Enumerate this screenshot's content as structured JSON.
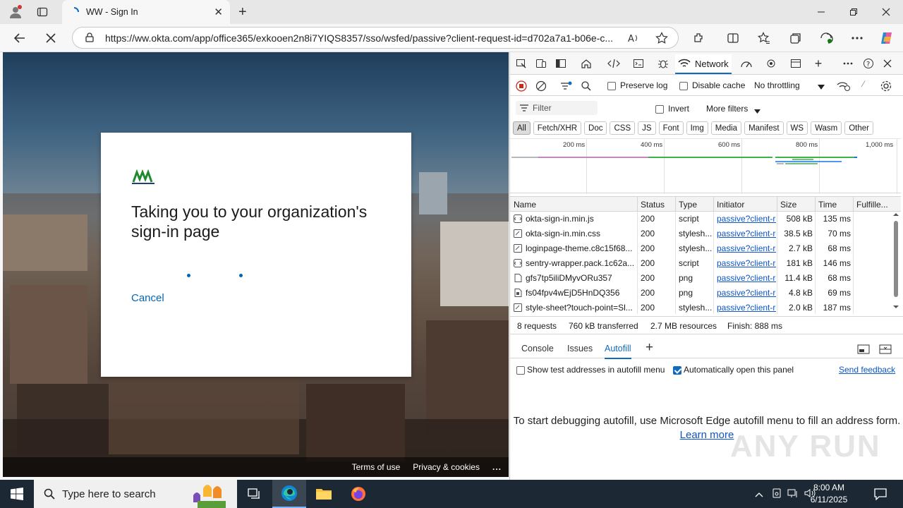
{
  "browser": {
    "tab_title": "WW - Sign In",
    "url": "https://ww.okta.com/app/office365/exkooen2n8i7YIQS8357/sso/wsfed/passive?client-request-id=d702a7a1-b06e-c..."
  },
  "signin_card": {
    "heading": "Taking you to your organization's sign-in page",
    "cancel_label": "Cancel"
  },
  "page_footer": {
    "terms": "Terms of use",
    "privacy": "Privacy & cookies",
    "more": "..."
  },
  "devtools": {
    "network_tab_label": "Network",
    "preserve_log": "Preserve log",
    "disable_cache": "Disable cache",
    "throttling": "No throttling",
    "filter_placeholder": "Filter",
    "invert": "Invert",
    "more_filters": "More filters",
    "type_filters": [
      "All",
      "Fetch/XHR",
      "Doc",
      "CSS",
      "JS",
      "Font",
      "Img",
      "Media",
      "Manifest",
      "WS",
      "Wasm",
      "Other"
    ],
    "timeline_labels": [
      "200 ms",
      "400 ms",
      "600 ms",
      "800 ms",
      "1,000 ms"
    ],
    "columns": [
      "Name",
      "Status",
      "Type",
      "Initiator",
      "Size",
      "Time",
      "Fulfille..."
    ],
    "rows": [
      {
        "name": "okta-sign-in.min.js",
        "status": "200",
        "type": "script",
        "initiator": "passive?client-re",
        "size": "508 kB",
        "time": "135 ms",
        "icon": "script-icon"
      },
      {
        "name": "okta-sign-in.min.css",
        "status": "200",
        "type": "stylesh...",
        "initiator": "passive?client-re",
        "size": "38.5 kB",
        "time": "70 ms",
        "icon": "stylesheet-icon"
      },
      {
        "name": "loginpage-theme.c8c15f68...",
        "status": "200",
        "type": "stylesh...",
        "initiator": "passive?client-re",
        "size": "2.7 kB",
        "time": "68 ms",
        "icon": "stylesheet-icon"
      },
      {
        "name": "sentry-wrapper.pack.1c62a...",
        "status": "200",
        "type": "script",
        "initiator": "passive?client-re",
        "size": "181 kB",
        "time": "146 ms",
        "icon": "script-icon"
      },
      {
        "name": "gfs7tp5iliDMyvORu357",
        "status": "200",
        "type": "png",
        "initiator": "passive?client-re",
        "size": "11.4 kB",
        "time": "68 ms",
        "icon": "document-icon"
      },
      {
        "name": "fs04fpv4wEjD5HnDQ356",
        "status": "200",
        "type": "png",
        "initiator": "passive?client-re",
        "size": "4.8 kB",
        "time": "69 ms",
        "icon": "image-icon"
      },
      {
        "name": "style-sheet?touch-point=Sl...",
        "status": "200",
        "type": "stylesh...",
        "initiator": "passive?client-re",
        "size": "2.0 kB",
        "time": "187 ms",
        "icon": "stylesheet-icon"
      }
    ],
    "summary": {
      "requests": "8 requests",
      "transferred": "760 kB transferred",
      "resources": "2.7 MB resources",
      "finish": "Finish: 888 ms"
    },
    "drawer_tabs": [
      "Console",
      "Issues",
      "Autofill"
    ],
    "autofill": {
      "show_test": "Show test addresses in autofill menu",
      "auto_open": "Automatically open this panel",
      "feedback": "Send feedback",
      "message": "To start debugging autofill, use Microsoft Edge autofill menu to fill an address form.",
      "learn_more": "Learn more"
    }
  },
  "watermark": "ANY RUN",
  "taskbar": {
    "search_placeholder": "Type here to search",
    "time": "8:00 AM",
    "date": "6/11/2025"
  },
  "colors": {
    "accent": "#0f6cbd",
    "link": "#0067b8",
    "taskbar": "#1c2833"
  }
}
